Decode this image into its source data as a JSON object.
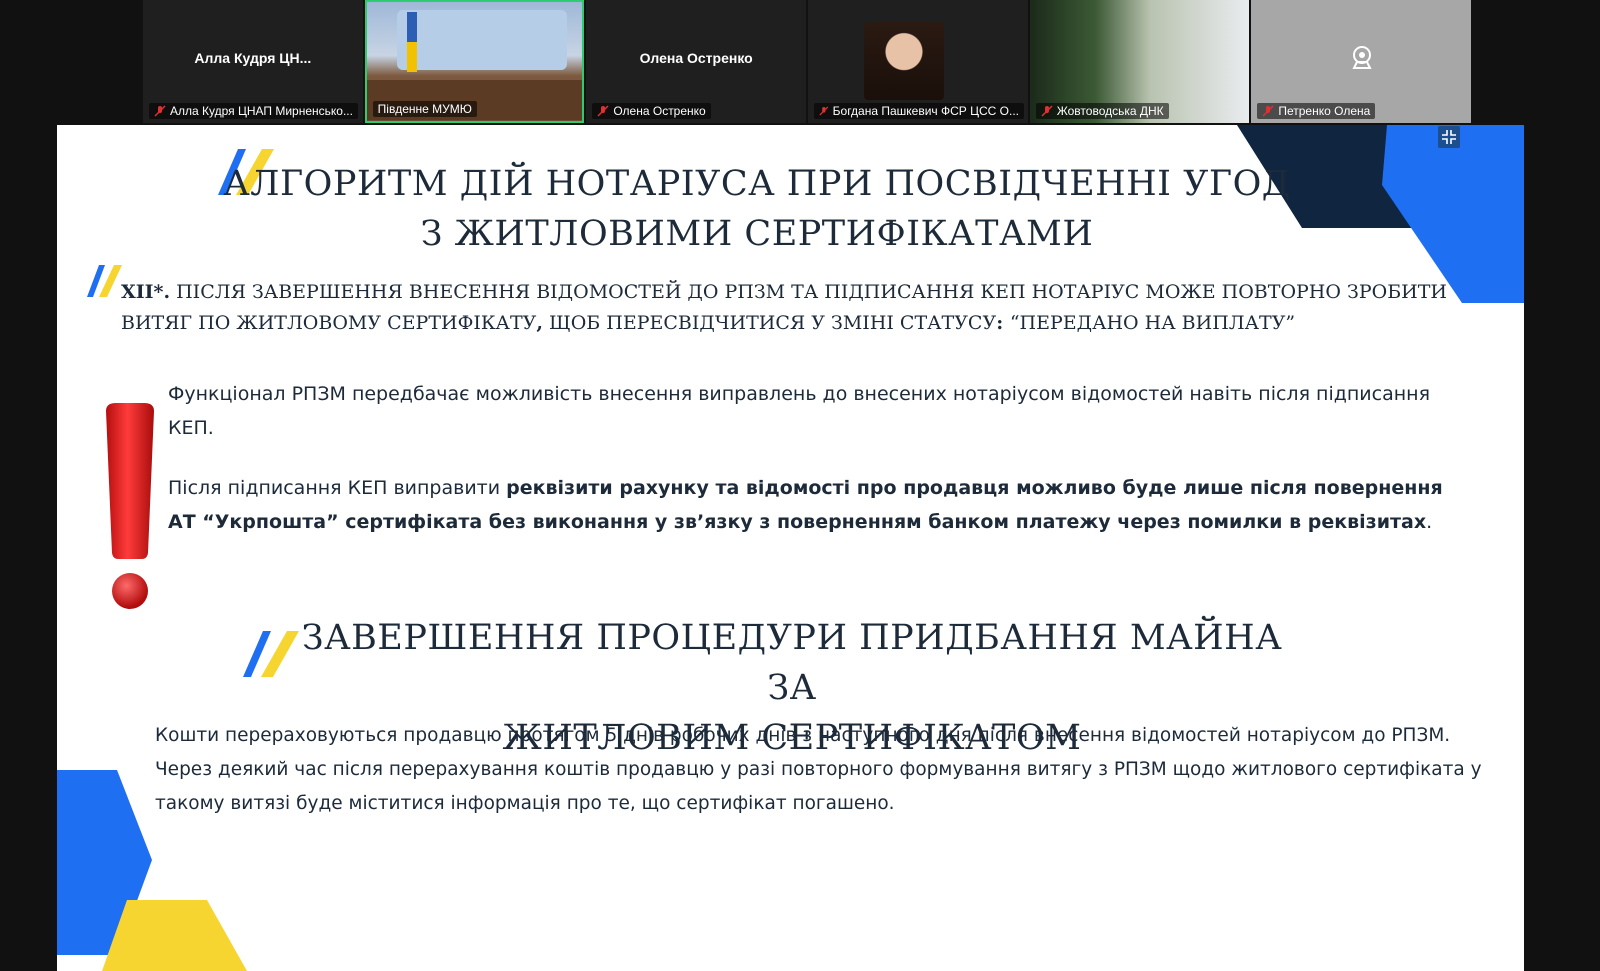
{
  "participants": [
    {
      "display_name": "Алла  Кудря  ЦН...",
      "label": "Алла Кудря ЦНАП Мирненсько...",
      "muted": true,
      "video": false
    },
    {
      "display_name": "",
      "label": "Південне МУМЮ",
      "muted": false,
      "video": true,
      "active": true
    },
    {
      "display_name": "Олена Остренко",
      "label": "Олена Остренко",
      "muted": true,
      "video": false
    },
    {
      "display_name": "",
      "label": "Богдана Пашкевич ФСР ЦСС О...",
      "muted": true,
      "video": false,
      "avatar": true
    },
    {
      "display_name": "",
      "label": "Жовтоводська ДНК",
      "muted": true,
      "video": true
    },
    {
      "display_name": "",
      "label": "Петренко Олена",
      "muted": true,
      "video": false,
      "camera_placeholder": true
    }
  ],
  "colors": {
    "blue": "#1f6ff2",
    "yellow": "#f7d531",
    "navy": "#0f2540",
    "text": "#1c2a3a",
    "active_border": "#2ecc71",
    "mic_off": "#e03131"
  },
  "slide": {
    "title_line1": "АЛГОРИТМ ДІЙ НОТАРІУСА ПРИ ПОСВІДЧЕННІ УГОД",
    "title_line2": "З ЖИТЛОВИМИ СЕРТИФІКАТАМИ",
    "step_prefix": "XII*.",
    "step_text1": " ПІСЛЯ ЗАВЕРШЕННЯ ВНЕСЕННЯ ВІДОМОСТЕЙ ДО РПЗМ ТА ПІДПИСАННЯ КЕП НОТАРІУС МОЖЕ ПОВТОРНО ЗРОБИТИ ВИТЯГ ПО ЖИТЛОВОМУ СЕРТИФІКАТУ",
    "step_comma": ",",
    "step_text2": " ЩОБ ПЕРЕСВІДЧИТИСЯ У ЗМІНІ СТАТУСУ",
    "step_colon": ": ",
    "step_status": "“ПЕРЕДАНО НА ВИПЛАТУ”",
    "para1": "Функціонал РПЗМ передбачає можливість внесення виправлень до внесених нотаріусом відомостей навіть після підписання КЕП.",
    "para2_plain": "Після підписання КЕП виправити ",
    "para2_bold": "реквізити рахунку та відомості про продавця можливо буде лише після повернення АТ “Укрпошта” сертифіката без виконання у зв’язку з поверненням банком платежу через помилки в реквізитах",
    "para2_end": ".",
    "section2_line1": "ЗАВЕРШЕННЯ ПРОЦЕДУРИ ПРИДБАННЯ МАЙНА ЗА",
    "section2_line2": "ЖИТЛОВИМ СЕРТИФІКАТОМ",
    "para3": "Кошти перераховуються продавцю протягом 5 днів робочих днів з наступного дня після внесення відомостей нотаріусом до РПЗМ. Через деякий час після перерахування коштів продавцю у разі повторного формування витягу з РПЗМ щодо житлового сертифіката у такому витязі буде міститися інформація про те, що сертифікат погашено."
  }
}
